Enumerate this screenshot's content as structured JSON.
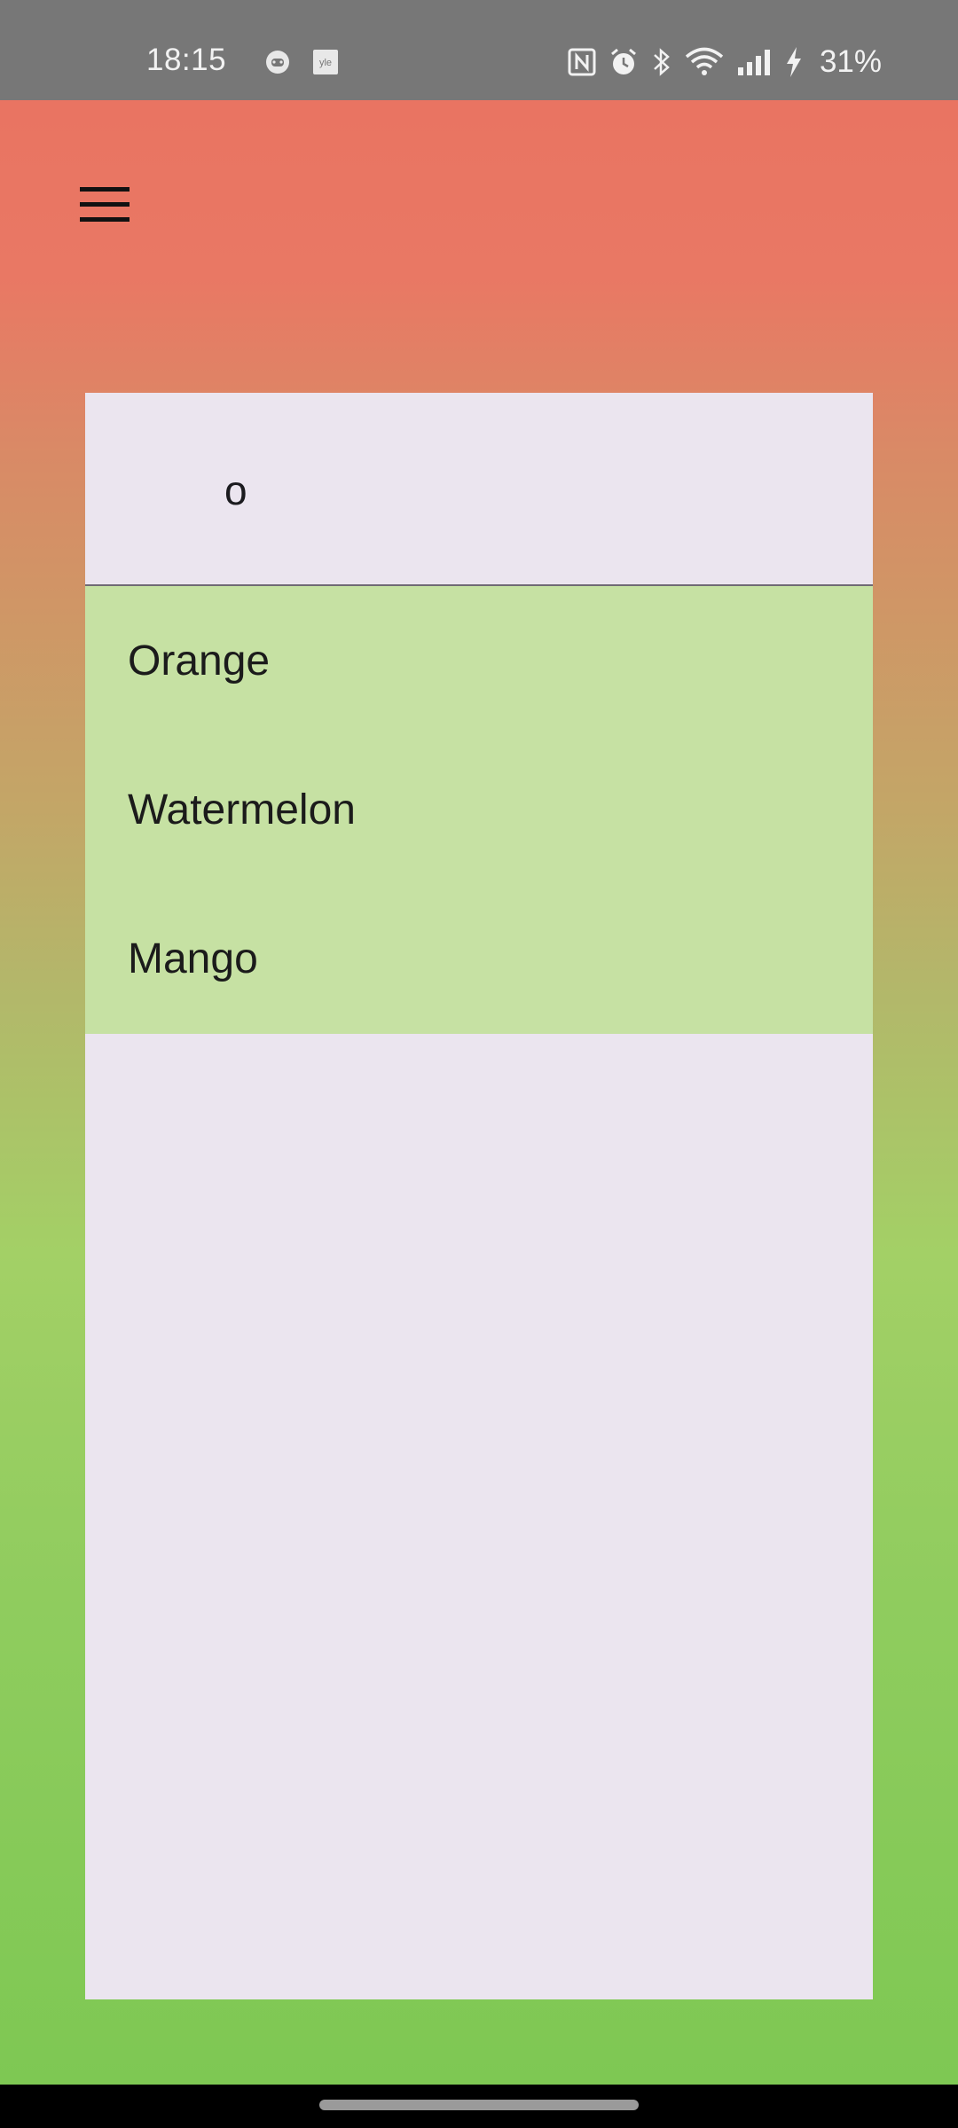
{
  "status_bar": {
    "time": "18:15",
    "battery": "31%",
    "icons": [
      "game-controller-icon",
      "yle-app-icon",
      "nfc-icon",
      "alarm-icon",
      "bluetooth-icon",
      "wifi-icon",
      "signal-icon",
      "charging-icon"
    ]
  },
  "header": {
    "menu_icon": "hamburger-menu-icon"
  },
  "search": {
    "value": "o"
  },
  "suggestions": [
    {
      "label": "Orange"
    },
    {
      "label": "Watermelon"
    },
    {
      "label": "Mango"
    }
  ],
  "colors": {
    "suggestions_bg": "#c6e1a3",
    "card_bg": "#ebe5ef",
    "gradient_top": "#e97462",
    "gradient_bottom": "#7ec853"
  }
}
